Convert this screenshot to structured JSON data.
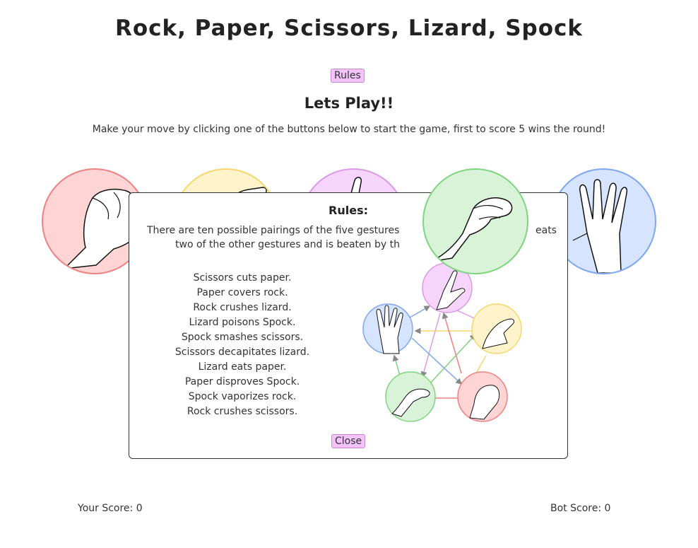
{
  "header": {
    "title": "Rock, Paper, Scissors, Lizard, Spock",
    "rules_label": "Rules"
  },
  "game": {
    "subtitle": "Lets Play!!",
    "instructions": "Make your move by clicking one of the buttons below to start the game, first to score 5 wins the round!",
    "moves": [
      {
        "name": "rock",
        "color": "#ffd4d4"
      },
      {
        "name": "paper",
        "color": "#fff3cc"
      },
      {
        "name": "scissors",
        "color": "#f7d4fb"
      },
      {
        "name": "lizard",
        "color": "#d9f3d9"
      },
      {
        "name": "spock",
        "color": "#d6e4ff"
      }
    ]
  },
  "modal": {
    "title": "Rules:",
    "intro_line1": "There are ten possible pairings of the five gestures",
    "intro_line1_end": "eats",
    "intro_line2": "two of the other gestures and is beaten by th",
    "rules": [
      "Scissors cuts paper.",
      "Paper covers rock.",
      "Rock crushes lizard.",
      "Lizard poisons Spock.",
      "Spock smashes scissors.",
      "Scissors decapitates lizard.",
      "Lizard eats paper.",
      "Paper disproves Spock.",
      "Spock vaporizes rock.",
      "Rock crushes scissors."
    ],
    "close_label": "Close"
  },
  "scores": {
    "you": "Your Score: 0",
    "bot": "Bot Score: 0"
  }
}
